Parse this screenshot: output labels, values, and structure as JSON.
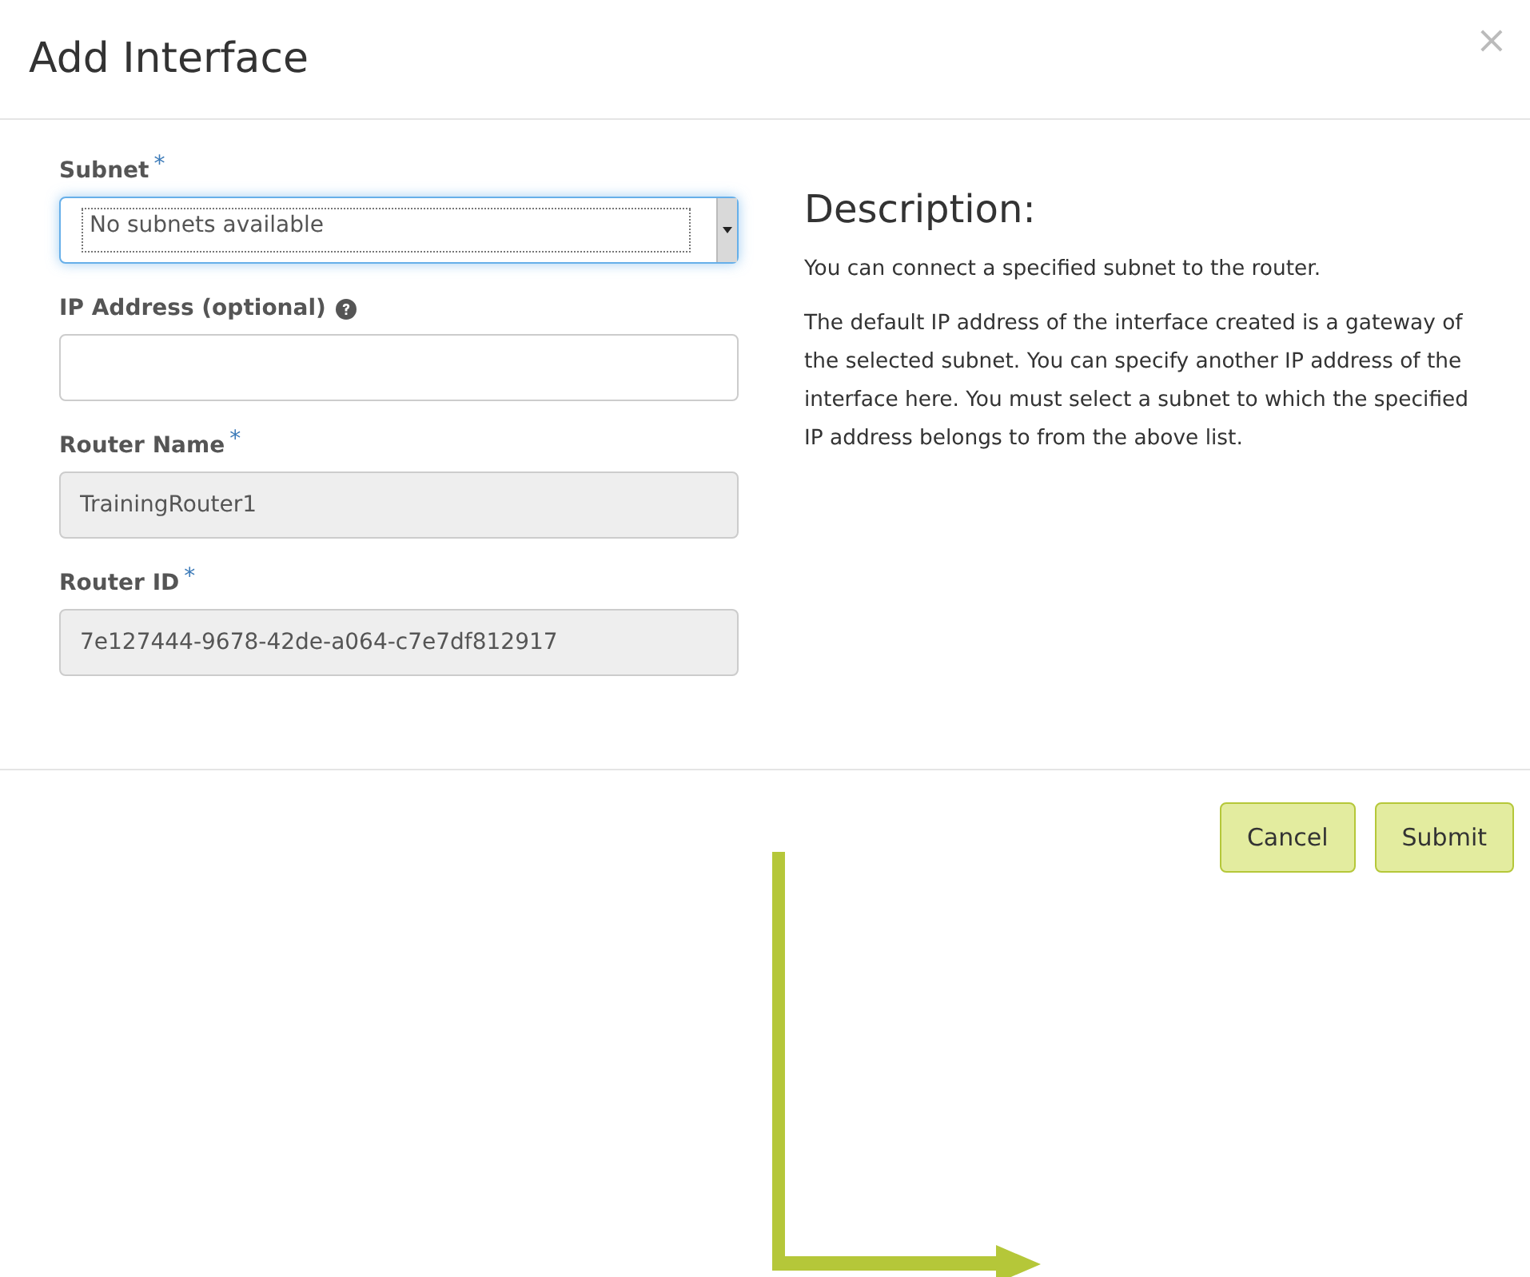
{
  "dialog": {
    "title": "Add Interface",
    "close": "×"
  },
  "fields": [
    {
      "kind": "select",
      "label": "Subnet",
      "required_mark": "*",
      "value": "No subnets available",
      "focused": true
    },
    {
      "kind": "text",
      "label": "IP Address (optional)",
      "help": true,
      "focused": false
    },
    {
      "kind": "readonly",
      "label": "Router Name",
      "required_mark": "*",
      "value": "TrainingRouter1",
      "focused": false
    },
    {
      "kind": "readonly",
      "label": "Router ID",
      "required_mark": "*",
      "value": "7e127444-9678-42de-a064-c7e7df812917",
      "focused": false
    }
  ],
  "description": {
    "heading": "Description:",
    "paragraphs": [
      "You can connect a specified subnet to the router.",
      "The default IP address of the interface created is a gateway of the selected subnet. You can specify another IP address of the interface here. You must select a subnet to which the specified IP address belongs to from the above list."
    ]
  },
  "buttons": [
    {
      "label": "Cancel"
    },
    {
      "label": "Submit"
    }
  ]
}
